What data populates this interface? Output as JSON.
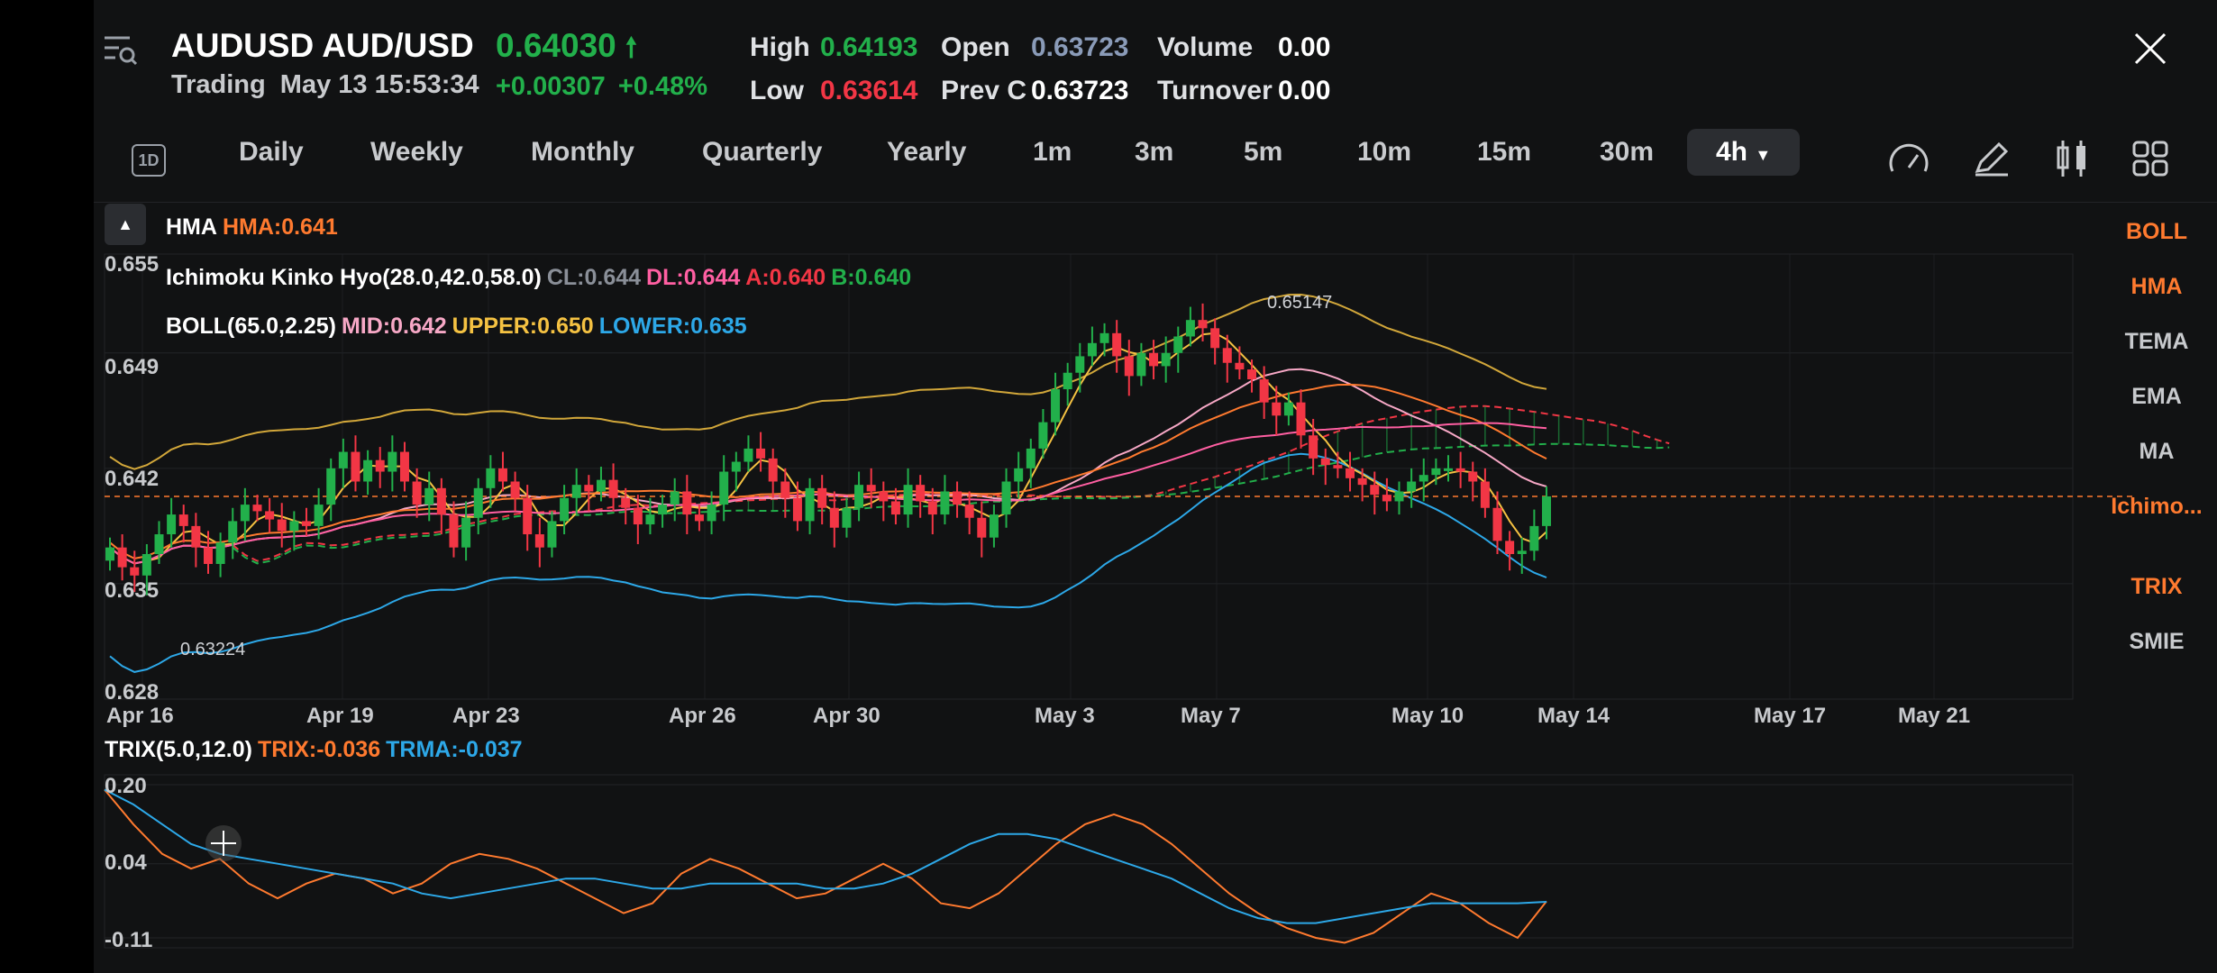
{
  "header": {
    "symbol": "AUDUSD",
    "pair": "AUD/USD",
    "price": "0.64030",
    "status": "Trading",
    "datetime": "May 13 15:53:34",
    "change": "+0.00307",
    "change_pct": "+0.48%",
    "high_label": "High",
    "high": "0.64193",
    "low_label": "Low",
    "low": "0.63614",
    "open_label": "Open",
    "open": "0.63723",
    "prevc_label": "Prev C",
    "prevc": "0.63723",
    "volume_label": "Volume",
    "volume": "0.00",
    "turnover_label": "Turnover",
    "turnover": "0.00"
  },
  "colors": {
    "up": "#22b04b",
    "down": "#f23645",
    "orange": "#ff7a2f",
    "yellow": "#f5c242",
    "blue": "#2da8e8",
    "pink": "#ff5fa2",
    "grey": "#8a8f98"
  },
  "timeframes": {
    "icon_label": "1D",
    "items": [
      "Daily",
      "Weekly",
      "Monthly",
      "Quarterly",
      "Yearly",
      "1m",
      "3m",
      "5m",
      "10m",
      "15m",
      "30m"
    ],
    "active": "4h"
  },
  "indicators": {
    "hma": {
      "name": "HMA",
      "value": "HMA:0.641"
    },
    "ichimoku": {
      "name": "Ichimoku Kinko Hyo(28.0,42.0,58.0)",
      "cl": "CL:0.644",
      "dl": "DL:0.644",
      "a": "A:0.640",
      "b": "B:0.640"
    },
    "boll": {
      "name": "BOLL(65.0,2.25)",
      "mid": "MID:0.642",
      "upper": "UPPER:0.650",
      "lower": "LOWER:0.635"
    },
    "trix": {
      "name": "TRIX(5.0,12.0)",
      "trix": "TRIX:-0.036",
      "trma": "TRMA:-0.037"
    }
  },
  "sidebar": {
    "items": [
      {
        "label": "BOLL",
        "active": true
      },
      {
        "label": "HMA",
        "active": true
      },
      {
        "label": "TEMA",
        "active": false
      },
      {
        "label": "EMA",
        "active": false
      },
      {
        "label": "MA",
        "active": false
      },
      {
        "label": "Ichimo...",
        "active": true
      },
      {
        "label": "TRIX",
        "active": true
      },
      {
        "label": "SMIE",
        "active": false
      }
    ]
  },
  "chart_data": [
    {
      "type": "candlestick",
      "y_tick_labels": [
        "0.655",
        "0.649",
        "0.642",
        "0.635",
        "0.628"
      ],
      "x_tick_labels": [
        "Apr 16",
        "Apr 19",
        "Apr 23",
        "Apr 26",
        "Apr 30",
        "May 3",
        "May 7",
        "May 10",
        "May 14",
        "May 17",
        "May 21"
      ],
      "max_label": "0.65147",
      "min_label": "0.63224",
      "ylim": [
        0.628,
        0.655
      ],
      "last_price": 0.6403,
      "close": [
        0.6372,
        0.636,
        0.6355,
        0.6368,
        0.638,
        0.6392,
        0.6385,
        0.6372,
        0.6362,
        0.6375,
        0.6388,
        0.6398,
        0.6394,
        0.6389,
        0.6382,
        0.6388,
        0.6385,
        0.6398,
        0.642,
        0.643,
        0.6412,
        0.6425,
        0.6418,
        0.643,
        0.6412,
        0.6398,
        0.6408,
        0.6392,
        0.6372,
        0.639,
        0.6408,
        0.642,
        0.6412,
        0.6402,
        0.638,
        0.6372,
        0.6388,
        0.6402,
        0.641,
        0.6406,
        0.6413,
        0.6402,
        0.6396,
        0.6386,
        0.6392,
        0.6398,
        0.6406,
        0.6392,
        0.6388,
        0.6398,
        0.6418,
        0.6424,
        0.6432,
        0.6426,
        0.6412,
        0.6402,
        0.6388,
        0.6408,
        0.6396,
        0.6384,
        0.6396,
        0.641,
        0.6406,
        0.64,
        0.6392,
        0.641,
        0.64,
        0.6392,
        0.6406,
        0.6398,
        0.639,
        0.6378,
        0.6392,
        0.6412,
        0.642,
        0.6432,
        0.6448,
        0.6468,
        0.6478,
        0.6488,
        0.6496,
        0.6502,
        0.6488,
        0.6476,
        0.649,
        0.6482,
        0.649,
        0.65,
        0.651,
        0.6505,
        0.6493,
        0.6484,
        0.648,
        0.6474,
        0.646,
        0.6452,
        0.646,
        0.644,
        0.6426,
        0.6422,
        0.642,
        0.6414,
        0.641,
        0.6404,
        0.64,
        0.6406,
        0.6412,
        0.6416,
        0.642,
        0.642,
        0.6418,
        0.6412,
        0.6396,
        0.6376,
        0.6368,
        0.637,
        0.6385,
        0.6403
      ]
    },
    {
      "type": "line",
      "y_tick_labels": [
        "0.20",
        "0.04",
        "-0.11"
      ],
      "ylim": [
        -0.13,
        0.22
      ],
      "series": [
        {
          "name": "TRIX",
          "values": [
            0.19,
            0.12,
            0.06,
            0.03,
            0.05,
            0.0,
            -0.03,
            0.0,
            0.02,
            0.01,
            -0.02,
            0.0,
            0.04,
            0.06,
            0.05,
            0.03,
            0.0,
            -0.03,
            -0.06,
            -0.04,
            0.02,
            0.05,
            0.03,
            0.0,
            -0.03,
            -0.02,
            0.01,
            0.04,
            0.01,
            -0.04,
            -0.05,
            -0.02,
            0.03,
            0.08,
            0.12,
            0.14,
            0.12,
            0.08,
            0.03,
            -0.02,
            -0.06,
            -0.09,
            -0.11,
            -0.12,
            -0.1,
            -0.06,
            -0.02,
            -0.04,
            -0.08,
            -0.11,
            -0.036
          ]
        },
        {
          "name": "TRMA",
          "values": [
            0.19,
            0.16,
            0.12,
            0.08,
            0.06,
            0.05,
            0.04,
            0.03,
            0.02,
            0.01,
            0.0,
            -0.02,
            -0.03,
            -0.02,
            -0.01,
            0.0,
            0.01,
            0.01,
            0.0,
            -0.01,
            -0.01,
            0.0,
            0.0,
            0.0,
            0.0,
            -0.01,
            -0.01,
            0.0,
            0.02,
            0.05,
            0.08,
            0.1,
            0.1,
            0.09,
            0.07,
            0.05,
            0.03,
            0.01,
            -0.02,
            -0.05,
            -0.07,
            -0.08,
            -0.08,
            -0.07,
            -0.06,
            -0.05,
            -0.04,
            -0.04,
            -0.04,
            -0.04,
            -0.037
          ]
        }
      ]
    }
  ]
}
